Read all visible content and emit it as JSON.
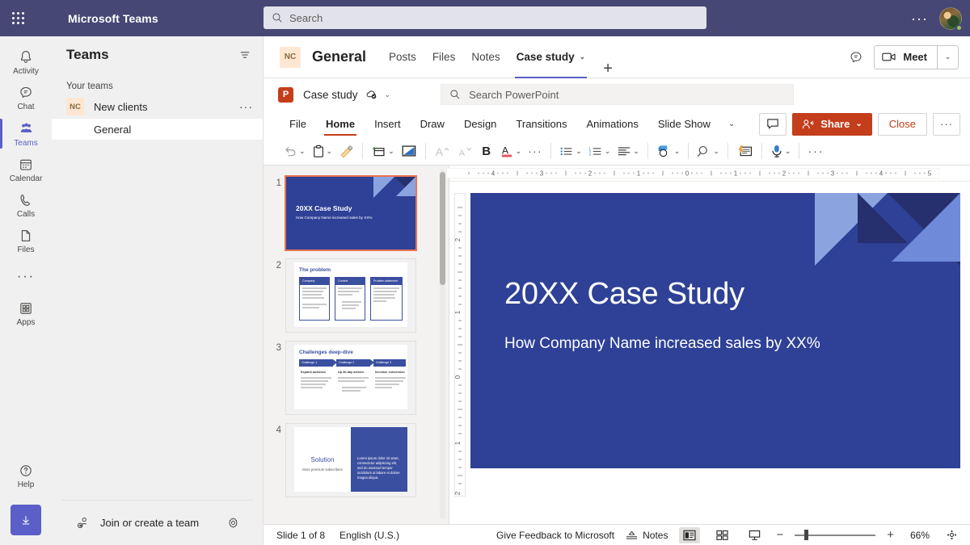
{
  "topbar": {
    "app_title": "Microsoft Teams",
    "search_placeholder": "Search",
    "more_label": "···"
  },
  "rail": {
    "items": [
      {
        "label": "Activity",
        "icon": "bell-icon"
      },
      {
        "label": "Chat",
        "icon": "chat-icon"
      },
      {
        "label": "Teams",
        "icon": "teams-icon"
      },
      {
        "label": "Calendar",
        "icon": "calendar-icon"
      },
      {
        "label": "Calls",
        "icon": "phone-icon"
      },
      {
        "label": "Files",
        "icon": "file-icon"
      }
    ],
    "more": "···",
    "apps": {
      "label": "Apps",
      "icon": "apps-icon"
    },
    "help": {
      "label": "Help",
      "icon": "help-icon"
    },
    "download_icon": "download-icon",
    "active_index": 2,
    "accent": "#5b5fc7"
  },
  "teams_panel": {
    "heading": "Teams",
    "filter_icon": "filter-icon",
    "section_label": "Your teams",
    "teams": [
      {
        "initials": "NC",
        "name": "New clients",
        "overflow": "···",
        "channels": [
          {
            "name": "General",
            "selected": true
          }
        ]
      }
    ],
    "footer": {
      "join_label": "Join or create a team",
      "join_icon": "add-people-icon",
      "settings_icon": "gear-icon"
    }
  },
  "channel_header": {
    "team_initials": "NC",
    "title": "General",
    "tabs": [
      {
        "label": "Posts",
        "active": false,
        "chevron": false
      },
      {
        "label": "Files",
        "active": false,
        "chevron": false
      },
      {
        "label": "Notes",
        "active": false,
        "chevron": false
      },
      {
        "label": "Case study",
        "active": true,
        "chevron": true
      }
    ],
    "add_tab": "+",
    "chat_icon": "chat-bubble-icon",
    "meet_label": "Meet",
    "meet_icon": "camera-icon",
    "meet_chevron": "⌄"
  },
  "powerpoint": {
    "logo_letter": "P",
    "doc_name": "Case study",
    "saved_icon": "autosave-cloud-icon",
    "doc_chevron": "⌄",
    "search_placeholder": "Search PowerPoint",
    "search_icon": "search-icon",
    "ribbon_tabs": [
      {
        "label": "File",
        "active": false
      },
      {
        "label": "Home",
        "active": true
      },
      {
        "label": "Insert",
        "active": false
      },
      {
        "label": "Draw",
        "active": false
      },
      {
        "label": "Design",
        "active": false
      },
      {
        "label": "Transitions",
        "active": false
      },
      {
        "label": "Animations",
        "active": false
      },
      {
        "label": "Slide Show",
        "active": false
      }
    ],
    "ribbon_tabs_chevron": "⌄",
    "comments_icon": "comment-icon",
    "share_label": "Share",
    "share_icon": "share-person-icon",
    "share_chevron": "⌄",
    "close_label": "Close",
    "more_label": "···",
    "accent_color": "#c43e1c",
    "ribbon_tools": [
      {
        "name": "undo-icon",
        "chevron": true
      },
      {
        "name": "paste-icon",
        "chevron": true
      },
      {
        "name": "format-painter-icon",
        "chevron": false
      },
      {
        "name": "new-slide-icon",
        "chevron": true
      },
      {
        "name": "layout-icon",
        "chevron": false
      },
      {
        "name": "increase-font-size-icon",
        "chevron": false
      },
      {
        "name": "decrease-font-size-icon",
        "chevron": false
      },
      {
        "name": "bold-icon",
        "chevron": false
      },
      {
        "name": "font-color-icon",
        "chevron": true
      },
      {
        "name": "more-font-options-icon",
        "chevron": false
      },
      {
        "name": "bullet-list-icon",
        "chevron": true
      },
      {
        "name": "numbered-list-icon",
        "chevron": true
      },
      {
        "name": "align-icon",
        "chevron": true
      },
      {
        "name": "shapes-icon",
        "chevron": true
      },
      {
        "name": "find-icon",
        "chevron": true
      },
      {
        "name": "designer-icon",
        "chevron": false
      },
      {
        "name": "dictate-icon",
        "chevron": true
      },
      {
        "name": "more-commands-icon",
        "chevron": false
      }
    ],
    "ribbon_collapse_icon": "chevron-down-icon"
  },
  "thumbnails": [
    {
      "number": "1",
      "selected": true,
      "kind": "title",
      "title": "20XX Case Study",
      "subtitle": "How Company Name increased sales by XX%"
    },
    {
      "number": "2",
      "selected": false,
      "kind": "three-col",
      "title": "The problem",
      "columns": [
        "Company",
        "Context",
        "Problem statement"
      ]
    },
    {
      "number": "3",
      "selected": false,
      "kind": "chevrons",
      "title": "Challenges deep-dive",
      "columns": [
        "Challenge 1",
        "Challenge 2",
        "Challenge 3"
      ],
      "subheads": [
        "Expand audience",
        "Up 30-day actives",
        "Increase conversion"
      ]
    },
    {
      "number": "4",
      "selected": false,
      "kind": "split",
      "title": "Solution",
      "subtitle": "More premium subscribers",
      "body": "Lorem ipsum dolor sit amet, consectetur adipiscing elit, sed do eiusmod tempor incididunt ut labore et dolore magna aliqua."
    }
  ],
  "ruler": {
    "horizontal_ticks": [
      "4",
      "3",
      "2",
      "1",
      "0",
      "1",
      "2",
      "3",
      "4",
      "5"
    ],
    "vertical_ticks": [
      "2",
      "1",
      "0",
      "1",
      "2"
    ]
  },
  "slide": {
    "title": "20XX Case Study",
    "subtitle": "How Company Name increased sales by XX%",
    "bg_color": "#2e4196",
    "accent_dark": "#27306e",
    "accent_light": "#8ba4e0",
    "accent_mid": "#4a5cb8"
  },
  "status_bar": {
    "slide_count": "Slide 1 of 8",
    "language": "English (U.S.)",
    "feedback": "Give Feedback to Microsoft",
    "notes_label": "Notes",
    "notes_icon": "notes-icon",
    "views": [
      {
        "icon": "normal-view-icon",
        "active": true
      },
      {
        "icon": "slide-sorter-icon",
        "active": false
      },
      {
        "icon": "reading-view-icon",
        "active": false
      }
    ],
    "zoom_out": "−",
    "zoom_in": "+",
    "zoom_level": "66%",
    "fit_icon": "fit-slide-icon"
  }
}
